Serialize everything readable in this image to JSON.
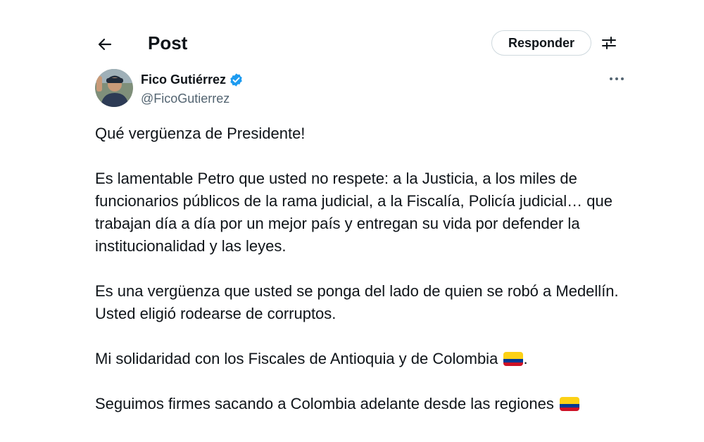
{
  "header": {
    "title": "Post",
    "reply_label": "Responder",
    "icons": [
      "arrow-left-icon",
      "adjust-icon"
    ]
  },
  "author": {
    "display_name": "Fico Gutiérrez",
    "handle": "@FicoGutierrez",
    "verified": true,
    "verified_color": "#1d9bf0",
    "more_icon": "more-horizontal-icon"
  },
  "tweet": {
    "p1": "Qué vergüenza de Presidente!",
    "p2": "Es lamentable Petro que usted no respete: a la Justicia, a los miles de funcionarios públicos de la rama judicial, a la Fiscalía, Policía judicial… que trabajan día a día por un mejor país y entregan su vida por defender la institucionalidad y las leyes.",
    "p3": "Es una vergüenza que usted se ponga del lado de quien se robó a Medellín. Usted eligió rodearse de corruptos.",
    "p4": "Mi solidaridad con los Fiscales de Antioquia y de Colombia",
    "p4_suffix": ".",
    "p5": "Seguimos firmes sacando a Colombia adelante desde las regiones",
    "flag_emoji": "colombia-flag-icon",
    "flag_colors": [
      "#fcd116",
      "#003893",
      "#ce1126"
    ]
  },
  "colors": {
    "text_primary": "#0f1419",
    "text_secondary": "#536471",
    "border": "#cfd9de"
  }
}
